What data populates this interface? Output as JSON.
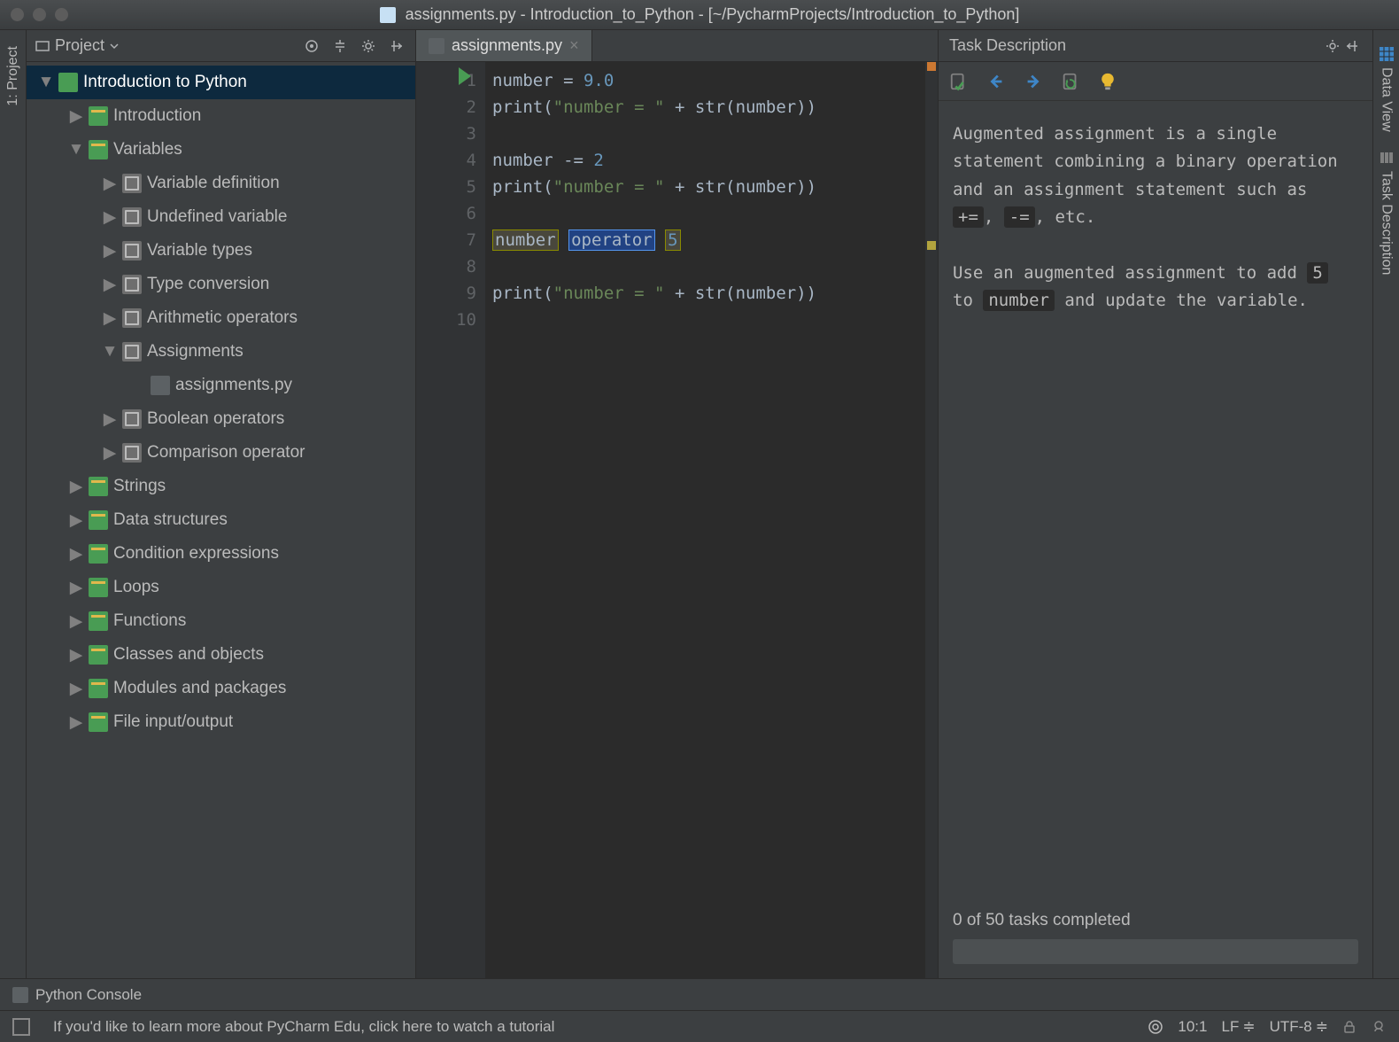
{
  "window": {
    "title": "assignments.py - Introduction_to_Python - [~/PycharmProjects/Introduction_to_Python]"
  },
  "leftStrip": {
    "project": "1: Project"
  },
  "rightStrip": {
    "dataView": "Data View",
    "taskDesc": "Task Description"
  },
  "projectPanel": {
    "title": "Project",
    "root": "Introduction to Python",
    "items": {
      "introduction": "Introduction",
      "variables": "Variables",
      "var_def": "Variable definition",
      "undef": "Undefined variable",
      "var_types": "Variable types",
      "type_conv": "Type conversion",
      "arith": "Arithmetic operators",
      "assignments": "Assignments",
      "assignments_py": "assignments.py",
      "bool_ops": "Boolean operators",
      "comp_op": "Comparison operator",
      "strings": "Strings",
      "data_struct": "Data structures",
      "cond": "Condition expressions",
      "loops": "Loops",
      "functions": "Functions",
      "classes": "Classes and objects",
      "modules": "Modules and packages",
      "fileio": "File input/output"
    }
  },
  "editor": {
    "tab": "assignments.py",
    "lineNumbers": [
      "1",
      "2",
      "3",
      "4",
      "5",
      "6",
      "7",
      "8",
      "9",
      "10"
    ],
    "code": {
      "l1a": "number ",
      "l1b": "= ",
      "l1c": "9.0",
      "l2a": "print",
      "l2b": "(",
      "l2c": "\"number = \"",
      "l2d": " + ",
      "l2e": "str",
      "l2f": "(number))",
      "l4a": "number ",
      "l4b": "-= ",
      "l4c": "2",
      "l5a": "print",
      "l5b": "(",
      "l5c": "\"number = \"",
      "l5d": " + ",
      "l5e": "str",
      "l5f": "(number))",
      "l7a": "number",
      "l7b": "operator",
      "l7c": "5",
      "l9a": "print",
      "l9b": "(",
      "l9c": "\"number = \"",
      "l9d": " + ",
      "l9e": "str",
      "l9f": "(number))"
    }
  },
  "task": {
    "title": "Task Description",
    "p1a": "Augmented assignment is a single statement combining a binary operation and an assignment statement such as ",
    "p1_code1": "+=",
    "p1_sep": ", ",
    "p1_code2": "-=",
    "p1b": ", etc.",
    "p2a": "Use an augmented assignment to add ",
    "p2_code1": "5",
    "p2b": " to ",
    "p2_code2": "number",
    "p2c": " and update the variable.",
    "progress": "0 of 50 tasks completed"
  },
  "console": {
    "label": "Python Console"
  },
  "status": {
    "tip": "If you'd like to learn more about PyCharm Edu, click here to watch a tutorial",
    "pos": "10:1",
    "lf": "LF",
    "enc": "UTF-8"
  }
}
